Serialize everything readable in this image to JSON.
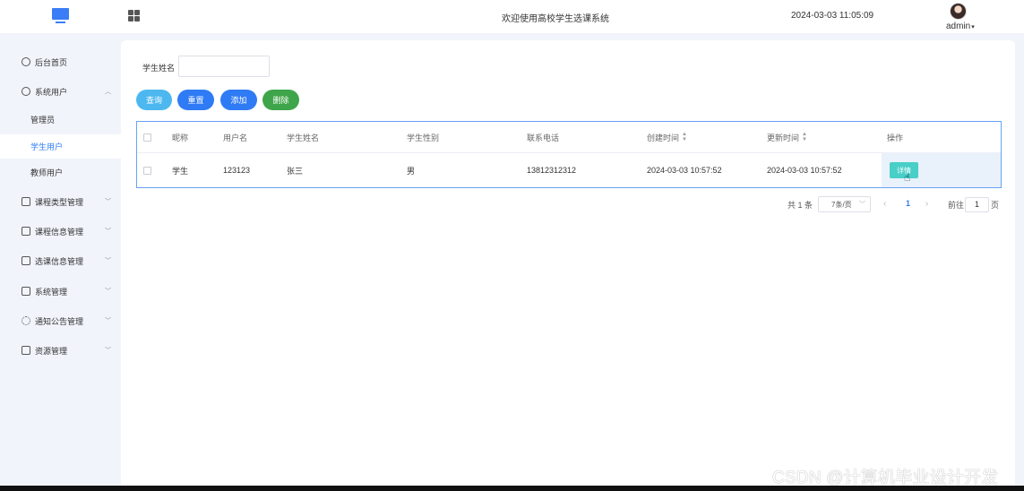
{
  "header": {
    "system_title": "欢迎使用高校学生选课系统",
    "datetime": "2024-03-03 11:05:09",
    "username": "admin",
    "icons": {
      "logo": "monitor-icon",
      "menu_toggle": "grid-icon",
      "user": "avatar"
    }
  },
  "sidebar": {
    "items": [
      {
        "label": "后台首页",
        "icon": "clock-icon"
      },
      {
        "label": "系统用户",
        "icon": "user-icon",
        "expanded": true
      },
      {
        "label": "管理员"
      },
      {
        "label": "学生用户",
        "active": true
      },
      {
        "label": "教师用户"
      },
      {
        "label": "课程类型管理",
        "icon": "card-icon"
      },
      {
        "label": "课程信息管理",
        "icon": "card-icon"
      },
      {
        "label": "选课信息管理",
        "icon": "card-icon"
      },
      {
        "label": "系统管理",
        "icon": "folder-icon"
      },
      {
        "label": "通知公告管理",
        "icon": "loading-icon"
      },
      {
        "label": "资源管理",
        "icon": "box-icon"
      }
    ]
  },
  "search": {
    "label": "学生姓名",
    "value": "",
    "placeholder": ""
  },
  "buttons": {
    "query": "查询",
    "reset": "重置",
    "add": "添加",
    "delete": "删除"
  },
  "colors": {
    "query": "#4db8f0",
    "reset": "#2f7bf5",
    "add": "#2f7bf5",
    "delete": "#3fa54a",
    "detail": "#47cfc8",
    "accent": "#2f7bf5"
  },
  "table": {
    "columns": [
      "昵称",
      "用户名",
      "学生姓名",
      "学生性别",
      "联系电话",
      "创建时间",
      "更新时间",
      "操作"
    ],
    "rows": [
      {
        "nickname": "学生",
        "username": "123123",
        "name": "张三",
        "gender": "男",
        "phone": "13812312312",
        "created": "2024-03-03 10:57:52",
        "updated": "2024-03-03 10:57:52",
        "action": "详情"
      }
    ]
  },
  "pagination": {
    "total": "共 1 条",
    "page_size": "7条/页",
    "current_page": "1",
    "goto_prefix": "前往",
    "goto_value": "1",
    "goto_suffix": "页"
  },
  "watermark": "CSDN @计算机毕业设计开发"
}
